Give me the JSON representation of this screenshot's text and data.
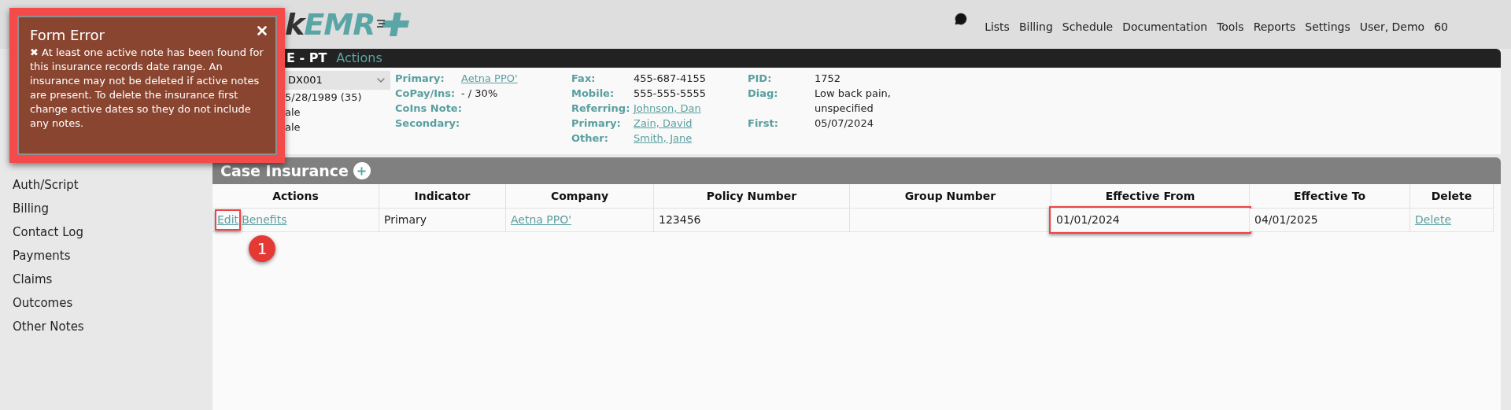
{
  "header": {
    "logo": {
      "dark_part": "k",
      "accent_part": "EMR"
    },
    "nav": {
      "items": [
        "Lists",
        "Billing",
        "Schedule",
        "Documentation",
        "Tools",
        "Reports",
        "Settings",
        "User, Demo"
      ],
      "badge": "60"
    }
  },
  "patient_bar": {
    "name_visible": "E - PT",
    "actions": "Actions"
  },
  "patient_info": {
    "case_select": "DX001",
    "left_values": [
      "5/28/1989 (35)",
      "ale",
      "ale"
    ],
    "columns": [
      [
        {
          "label": "Primary:",
          "value": "Aetna PPO'",
          "kind": "link"
        },
        {
          "label": "CoPay/Ins:",
          "value": "- / 30%",
          "kind": "text"
        },
        {
          "label": "CoIns Note:",
          "kind": "empty"
        },
        {
          "label": "Secondary:",
          "kind": "empty"
        }
      ],
      [
        {
          "label": "Fax:",
          "value": "455-687-4155",
          "kind": "text"
        },
        {
          "label": "Mobile:",
          "value": "555-555-5555",
          "kind": "text"
        },
        {
          "label": "Referring:",
          "value": "Johnson, Dan",
          "kind": "link"
        },
        {
          "label": "Primary:",
          "value": "Zain, David",
          "kind": "link"
        },
        {
          "label": "Other:",
          "value": "Smith, Jane",
          "kind": "link"
        }
      ],
      [
        {
          "label": "PID:",
          "value": "1752",
          "kind": "text"
        },
        {
          "label": "Diag:",
          "value": "Low back pain, unspecified",
          "kind": "text"
        },
        {
          "label": "First:",
          "value": "05/07/2024",
          "kind": "text"
        }
      ]
    ]
  },
  "sidebar": {
    "items": [
      "Auth/Script",
      "Billing",
      "Contact Log",
      "Payments",
      "Claims",
      "Outcomes",
      "Other Notes"
    ]
  },
  "case_insurance": {
    "title": "Case Insurance",
    "columns": [
      "Actions",
      "Indicator",
      "Company",
      "Policy Number",
      "Group Number",
      "Effective From",
      "Effective To",
      "Delete"
    ],
    "rows": [
      {
        "actions": [
          {
            "text": "Edit",
            "highlighted": true
          },
          {
            "text": "Benefits",
            "highlighted": false
          }
        ],
        "cells": [
          {
            "kind": "text",
            "text": "Primary",
            "highlighted": false
          },
          {
            "kind": "link",
            "text": "Aetna PPO'",
            "highlighted": false
          },
          {
            "kind": "text",
            "text": "123456",
            "highlighted": false
          },
          {
            "kind": "empty"
          },
          {
            "kind": "text",
            "text": "01/01/2024",
            "highlighted": true
          },
          {
            "kind": "text",
            "text": "04/01/2025",
            "highlighted": false
          },
          {
            "kind": "link",
            "text": "Delete",
            "highlighted": false
          }
        ]
      }
    ]
  },
  "step_marker": "1",
  "error_popup": {
    "title": "Form Error",
    "icon": "✖",
    "message": "At least one active note has been found for this insurance records date range. An insurance may not be deleted if active notes are present. To delete the insurance first change active dates so they do not include any notes."
  }
}
